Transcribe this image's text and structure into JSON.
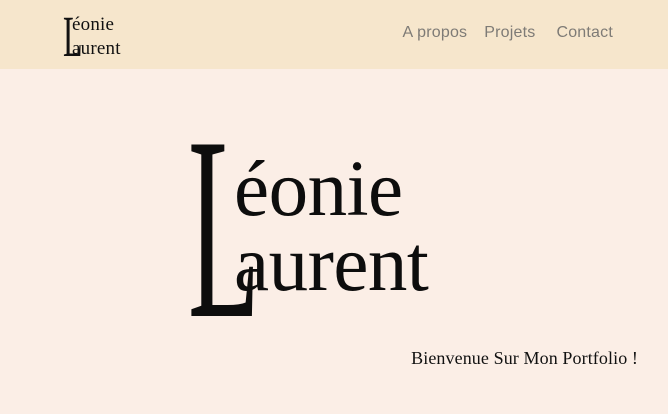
{
  "header": {
    "logo": {
      "initial": "L",
      "line1": "éonie",
      "line2": "aurent"
    },
    "nav": [
      {
        "label": "A propos"
      },
      {
        "label": "Projets"
      },
      {
        "label": "Contact"
      }
    ]
  },
  "hero": {
    "initial": "L",
    "line1": "éonie",
    "line2": "aurent",
    "tagline": "Bienvenue Sur Mon Portfolio !"
  },
  "colors": {
    "header_background": "#f6e6cc",
    "page_background": "#fbeee6",
    "nav_text": "#7e7b76",
    "ink": "#111111"
  }
}
